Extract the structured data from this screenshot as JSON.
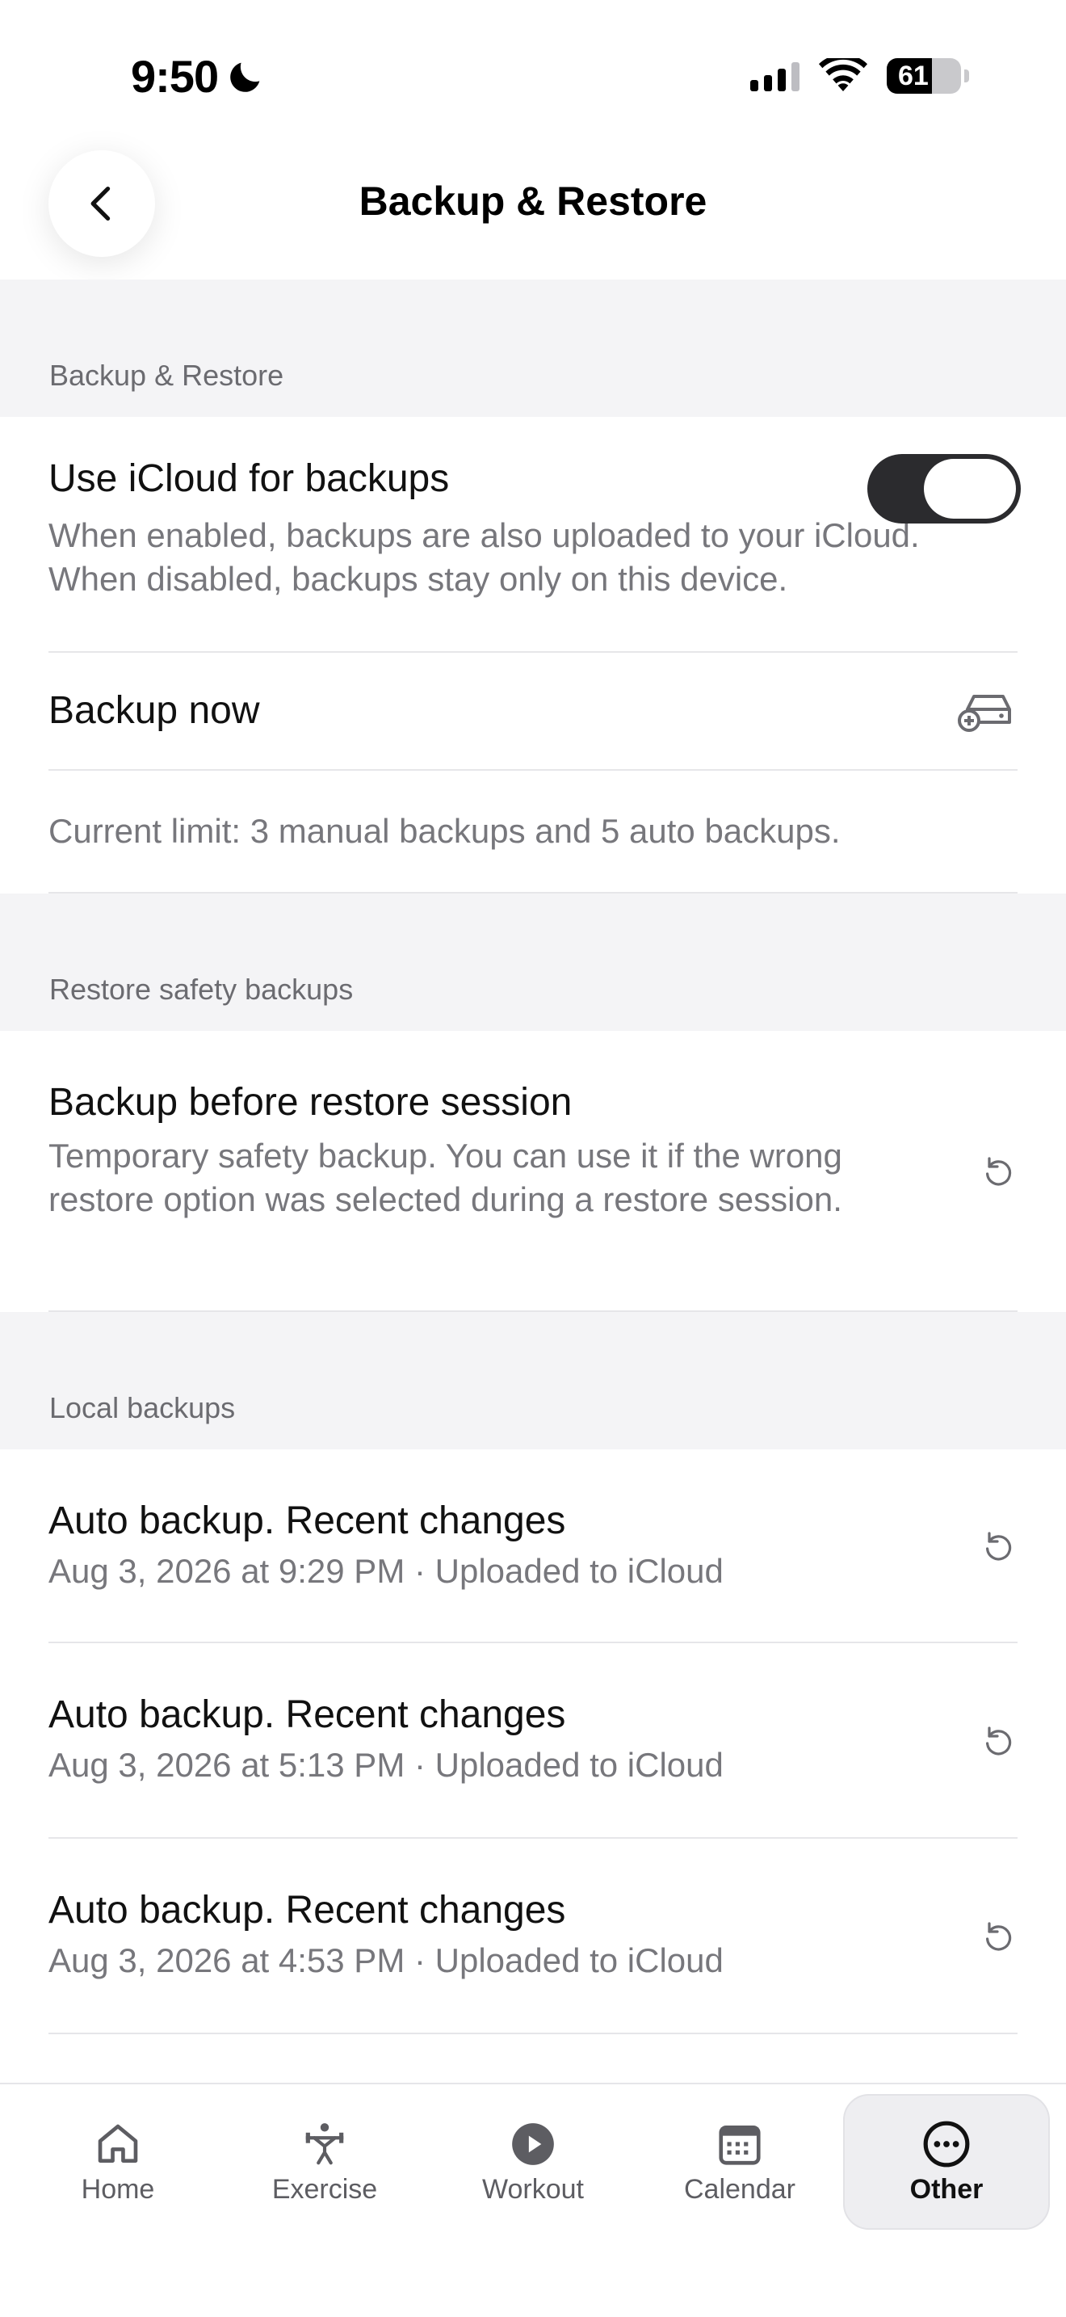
{
  "status_bar": {
    "time": "9:50",
    "battery": "61",
    "battery_level": 0.61
  },
  "header": {
    "title": "Backup & Restore",
    "back_icon": "chevron-left-icon"
  },
  "sections": {
    "backup": {
      "header": "Backup & Restore",
      "icloud": {
        "title": "Use iCloud for backups",
        "description": "When enabled, backups are also uploaded to your iCloud. When disabled, backups stay only on this device.",
        "enabled": true
      },
      "backup_now": {
        "title": "Backup now",
        "icon": "add-backup-icon"
      },
      "limit_text": "Current limit: 3 manual backups and 5 auto backups."
    },
    "safety": {
      "header": "Restore safety backups",
      "item": {
        "title": "Backup before restore session",
        "description": "Temporary safety backup. You can use it if the wrong restore option was selected during a restore session."
      }
    },
    "local": {
      "header": "Local backups",
      "items": [
        {
          "title": "Auto backup. Recent changes",
          "subtitle": "Aug 3, 2026 at 9:29 PM · Uploaded to iCloud"
        },
        {
          "title": "Auto backup. Recent changes",
          "subtitle": "Aug 3, 2026 at 5:13 PM · Uploaded to iCloud"
        },
        {
          "title": "Auto backup. Recent changes",
          "subtitle": "Aug 3, 2026 at 4:53 PM · Uploaded to iCloud"
        }
      ]
    }
  },
  "tab_bar": {
    "tabs": [
      {
        "label": "Home",
        "icon": "home-icon"
      },
      {
        "label": "Exercise",
        "icon": "exercise-icon"
      },
      {
        "label": "Workout",
        "icon": "play-icon"
      },
      {
        "label": "Calendar",
        "icon": "calendar-icon"
      },
      {
        "label": "Other",
        "icon": "more-icon",
        "active": true
      }
    ]
  },
  "colors": {
    "toggle_on": "#2b2b2e",
    "section_bg": "#f4f4f6",
    "secondary_text": "#77777c"
  }
}
